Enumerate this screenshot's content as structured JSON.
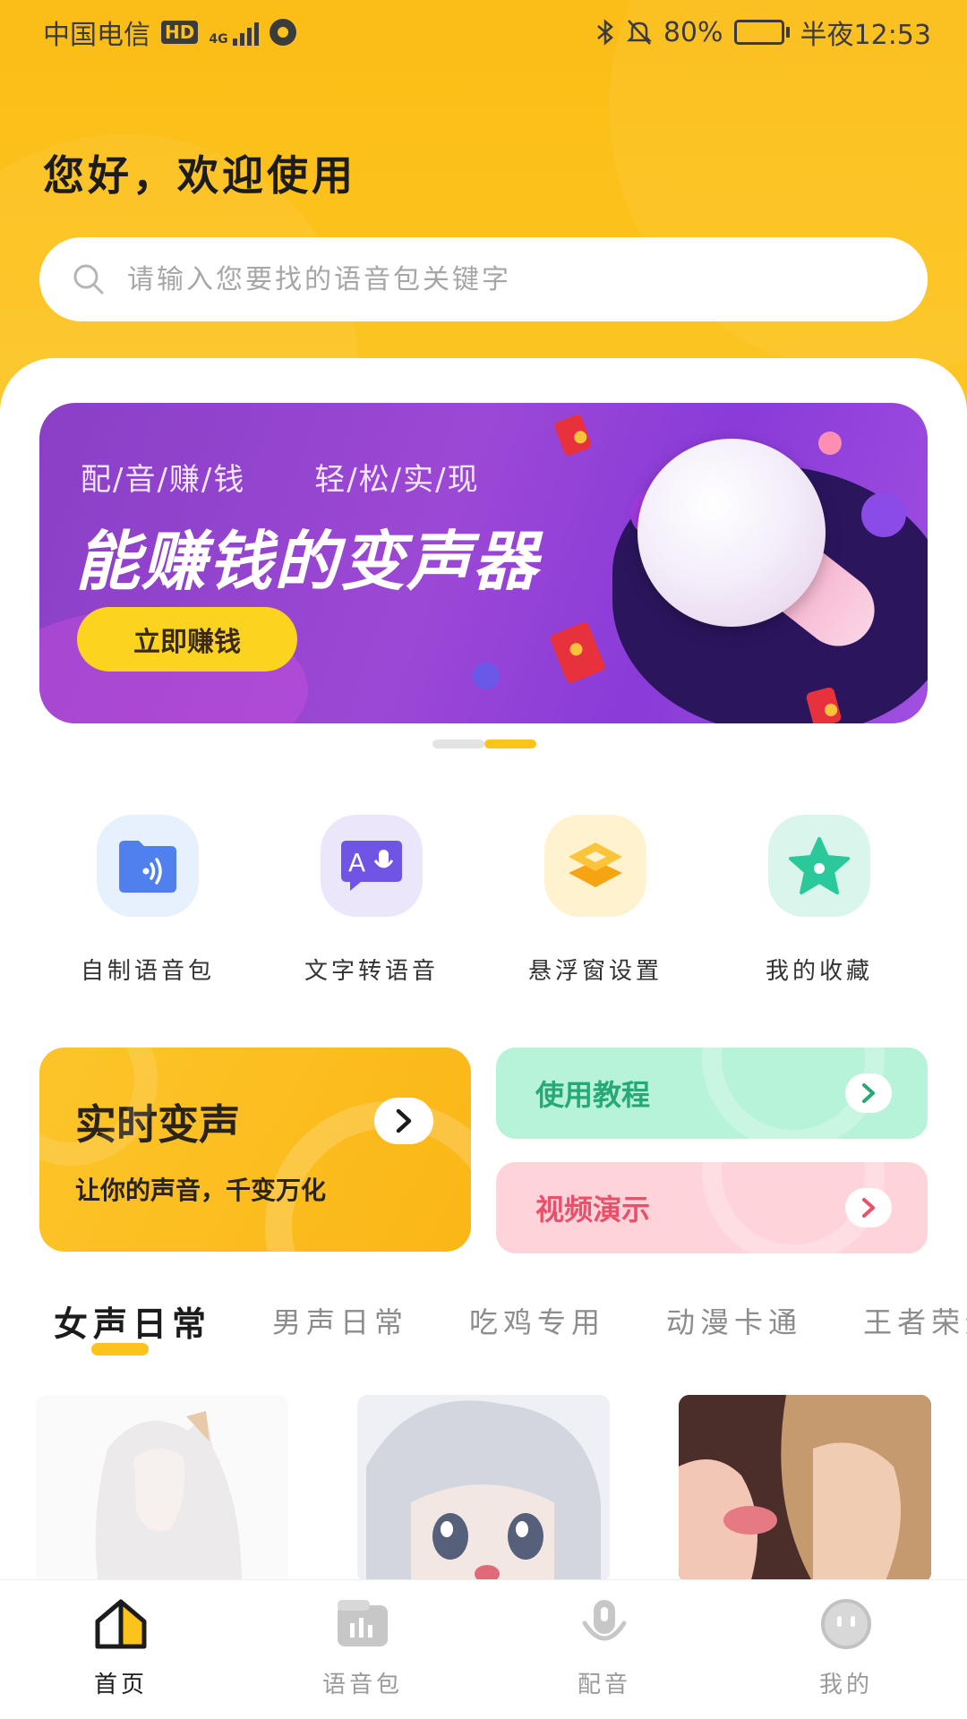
{
  "status_bar": {
    "carrier": "中国电信",
    "hd": "HD",
    "network": "4G",
    "battery_text": "80%",
    "battery_level": 0.8,
    "time": "半夜12:53"
  },
  "greeting": "您好，欢迎使用",
  "search": {
    "placeholder": "请输入您要找的语音包关键字"
  },
  "banner": {
    "subtitle": "配/音/赚/钱      轻/松/实/现",
    "title": "能赚钱的变声器",
    "button": "立即赚钱",
    "page_count": 2,
    "active_page": 2
  },
  "quick_actions": [
    {
      "label": "自制语音包",
      "icon": "voice-folder-icon",
      "bg": "#e6f1fd",
      "color": "#4f80ee"
    },
    {
      "label": "文字转语音",
      "icon": "text-to-speech-icon",
      "bg": "#ece6fb",
      "color": "#7054e6"
    },
    {
      "label": "悬浮窗设置",
      "icon": "floating-window-icon",
      "bg": "#fff3cf",
      "color": "#fbb21a"
    },
    {
      "label": "我的收藏",
      "icon": "star-icon",
      "bg": "#d9f5ec",
      "color": "#2ac89a"
    }
  ],
  "feature_cards": {
    "live": {
      "title": "实时变声",
      "subtitle": "让你的声音，千变万化"
    },
    "tutorial": {
      "title": "使用教程",
      "bg": "#b6f3d8",
      "color": "#27a874"
    },
    "video": {
      "title": "视频演示",
      "bg": "#ffd3da",
      "color": "#e9506a"
    }
  },
  "categories": [
    "女声日常",
    "男声日常",
    "吃鸡专用",
    "动漫卡通",
    "王者荣耀"
  ],
  "active_category": 0,
  "nav": [
    {
      "label": "首页",
      "icon": "home-icon",
      "active": true
    },
    {
      "label": "语音包",
      "icon": "voice-pack-icon",
      "active": false
    },
    {
      "label": "配音",
      "icon": "microphone-icon",
      "active": false
    },
    {
      "label": "我的",
      "icon": "profile-icon",
      "active": false
    }
  ],
  "colors": {
    "brand": "#fcc31c",
    "banner_purple": "#9c48d6",
    "text_dark": "#1c1c1c",
    "text_muted": "#9a9a9a"
  }
}
